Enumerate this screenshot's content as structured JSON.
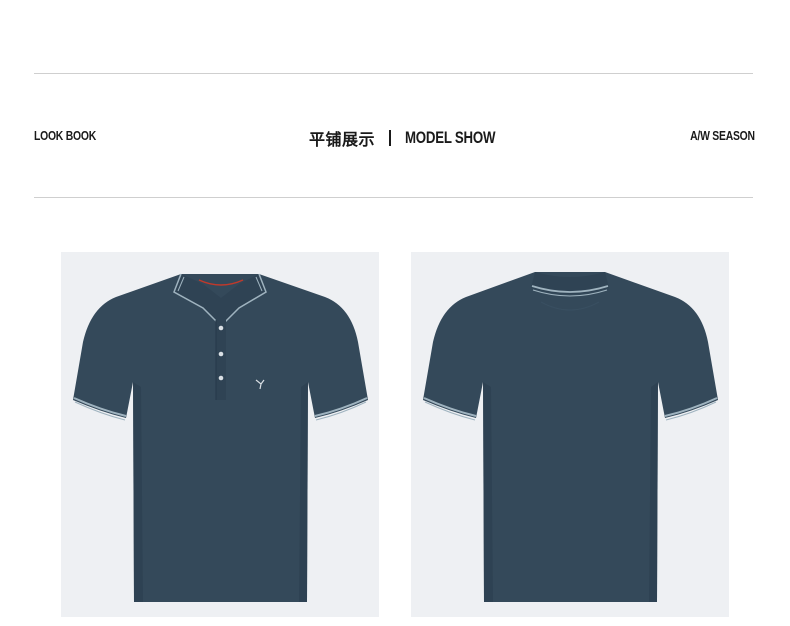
{
  "header": {
    "left_label": "LOOK BOOK",
    "title_cn": "平铺展示",
    "title_en": "MODEL SHOW",
    "right_label": "A/W SEASON"
  },
  "colors": {
    "shirt": "#34495a",
    "shirt_shadow": "#2c3e4e",
    "trim": "#9fb3bf",
    "panel_bg": "#eef0f3",
    "rule": "#cfcfcf"
  },
  "images": [
    {
      "name": "polo-front",
      "view": "front"
    },
    {
      "name": "polo-back",
      "view": "back"
    }
  ]
}
